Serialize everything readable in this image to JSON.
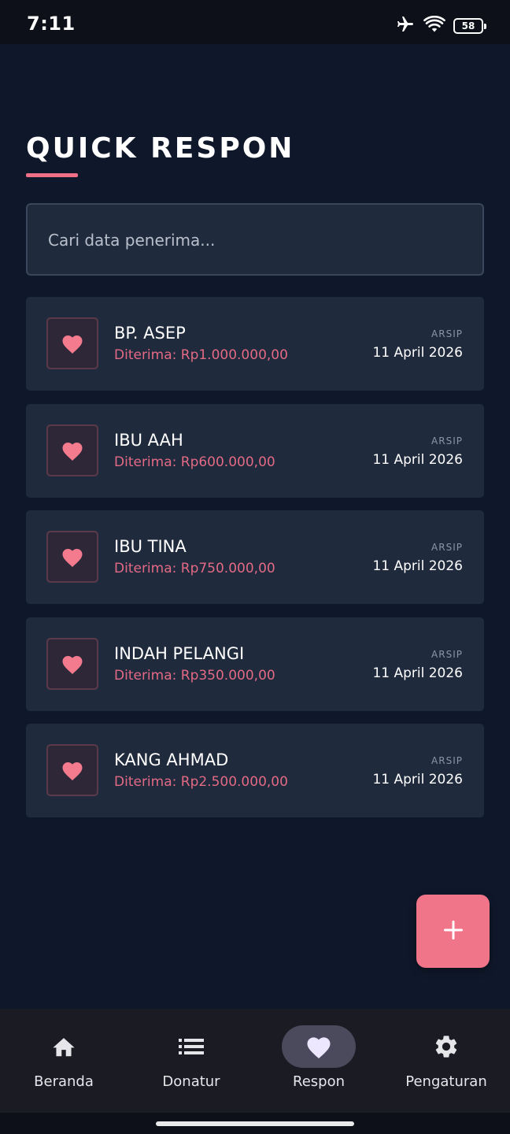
{
  "status_bar": {
    "time": "7:11",
    "battery_level": "58",
    "icons": [
      "airplane-icon",
      "wifi-icon",
      "battery-icon"
    ]
  },
  "header": {
    "title": "QUICK RESPON"
  },
  "search": {
    "placeholder": "Cari data penerima..."
  },
  "recipients": [
    {
      "name": "BP. ASEP",
      "amount": "Diterima: Rp1.000.000,00",
      "tag": "ARSIP",
      "date": "11 April 2026"
    },
    {
      "name": "IBU AAH",
      "amount": "Diterima: Rp600.000,00",
      "tag": "ARSIP",
      "date": "11 April 2026"
    },
    {
      "name": "IBU TINA",
      "amount": "Diterima: Rp750.000,00",
      "tag": "ARSIP",
      "date": "11 April 2026"
    },
    {
      "name": "INDAH PELANGI",
      "amount": "Diterima: Rp350.000,00",
      "tag": "ARSIP",
      "date": "11 April 2026"
    },
    {
      "name": "KANG AHMAD",
      "amount": "Diterima: Rp2.500.000,00",
      "tag": "ARSIP",
      "date": "11 April 2026"
    }
  ],
  "fab": {
    "icon": "plus-icon"
  },
  "bottom_nav": {
    "items": [
      {
        "label": "Beranda",
        "icon": "home-icon",
        "active": false
      },
      {
        "label": "Donatur",
        "icon": "list-icon",
        "active": false
      },
      {
        "label": "Respon",
        "icon": "heart-icon",
        "active": true
      },
      {
        "label": "Pengaturan",
        "icon": "gear-icon",
        "active": false
      }
    ]
  },
  "colors": {
    "background": "#0f182a",
    "card": "#1f2a3d",
    "accent": "#f17589",
    "amount_text": "#e36a84",
    "nav_background": "#1b1c23",
    "nav_active_pill": "#4b4a5c"
  }
}
